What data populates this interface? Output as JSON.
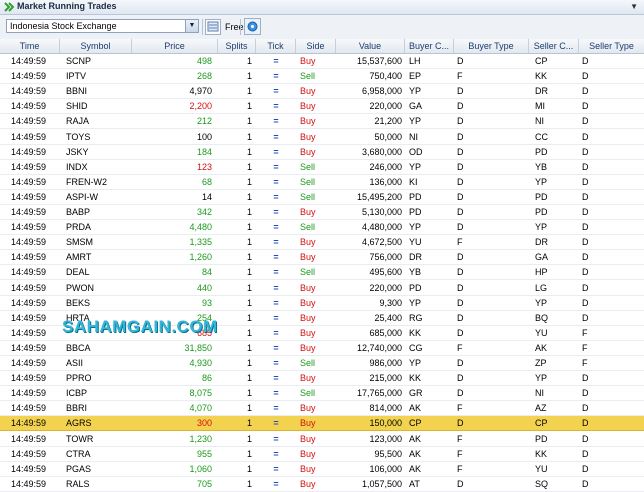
{
  "window": {
    "title": "Market Running Trades"
  },
  "toolbar": {
    "exchange": "Indonesia Stock Exchange",
    "freeze_label": "Freeze"
  },
  "columns": [
    "Time",
    "Symbol",
    "Price",
    "Splits",
    "Tick",
    "Side",
    "Value",
    "Buyer C...",
    "Buyer Type",
    "Seller C...",
    "Seller Type"
  ],
  "watermark": "SAHAMGAIN.COM",
  "colors": {
    "up": "#1a9b1a",
    "down": "#d21010",
    "highlight": "#f2d24f",
    "header_text": "#1e3b6f"
  },
  "trades": [
    {
      "time": "14:49:59",
      "symbol": "SCNP",
      "price": "498",
      "price_dir": "up",
      "splits": "1",
      "tick": "=",
      "side": "Buy",
      "value": "15,537,600",
      "buyer_code": "LH",
      "buyer_type": "D",
      "seller_code": "CP",
      "seller_type": "D"
    },
    {
      "time": "14:49:59",
      "symbol": "IPTV",
      "price": "268",
      "price_dir": "up",
      "splits": "1",
      "tick": "=",
      "side": "Sell",
      "value": "750,400",
      "buyer_code": "EP",
      "buyer_type": "F",
      "seller_code": "KK",
      "seller_type": "D"
    },
    {
      "time": "14:49:59",
      "symbol": "BBNI",
      "price": "4,970",
      "price_dir": "flat",
      "splits": "1",
      "tick": "=",
      "side": "Buy",
      "value": "6,958,000",
      "buyer_code": "YP",
      "buyer_type": "D",
      "seller_code": "DR",
      "seller_type": "D"
    },
    {
      "time": "14:49:59",
      "symbol": "SHID",
      "price": "2,200",
      "price_dir": "down",
      "splits": "1",
      "tick": "=",
      "side": "Buy",
      "value": "220,000",
      "buyer_code": "GA",
      "buyer_type": "D",
      "seller_code": "MI",
      "seller_type": "D"
    },
    {
      "time": "14:49:59",
      "symbol": "RAJA",
      "price": "212",
      "price_dir": "up",
      "splits": "1",
      "tick": "=",
      "side": "Buy",
      "value": "21,200",
      "buyer_code": "YP",
      "buyer_type": "D",
      "seller_code": "NI",
      "seller_type": "D"
    },
    {
      "time": "14:49:59",
      "symbol": "TOYS",
      "price": "100",
      "price_dir": "flat",
      "splits": "1",
      "tick": "=",
      "side": "Buy",
      "value": "50,000",
      "buyer_code": "NI",
      "buyer_type": "D",
      "seller_code": "CC",
      "seller_type": "D"
    },
    {
      "time": "14:49:59",
      "symbol": "JSKY",
      "price": "184",
      "price_dir": "up",
      "splits": "1",
      "tick": "=",
      "side": "Buy",
      "value": "3,680,000",
      "buyer_code": "OD",
      "buyer_type": "D",
      "seller_code": "PD",
      "seller_type": "D"
    },
    {
      "time": "14:49:59",
      "symbol": "INDX",
      "price": "123",
      "price_dir": "down",
      "splits": "1",
      "tick": "=",
      "side": "Sell",
      "value": "246,000",
      "buyer_code": "YP",
      "buyer_type": "D",
      "seller_code": "YB",
      "seller_type": "D"
    },
    {
      "time": "14:49:59",
      "symbol": "FREN-W2",
      "price": "68",
      "price_dir": "up",
      "splits": "1",
      "tick": "=",
      "side": "Sell",
      "value": "136,000",
      "buyer_code": "KI",
      "buyer_type": "D",
      "seller_code": "YP",
      "seller_type": "D"
    },
    {
      "time": "14:49:59",
      "symbol": "ASPI-W",
      "price": "14",
      "price_dir": "flat",
      "splits": "1",
      "tick": "=",
      "side": "Sell",
      "value": "15,495,200",
      "buyer_code": "PD",
      "buyer_type": "D",
      "seller_code": "PD",
      "seller_type": "D"
    },
    {
      "time": "14:49:59",
      "symbol": "BABP",
      "price": "342",
      "price_dir": "up",
      "splits": "1",
      "tick": "=",
      "side": "Buy",
      "value": "5,130,000",
      "buyer_code": "PD",
      "buyer_type": "D",
      "seller_code": "PD",
      "seller_type": "D"
    },
    {
      "time": "14:49:59",
      "symbol": "PRDA",
      "price": "4,480",
      "price_dir": "up",
      "splits": "1",
      "tick": "=",
      "side": "Sell",
      "value": "4,480,000",
      "buyer_code": "YP",
      "buyer_type": "D",
      "seller_code": "YP",
      "seller_type": "D"
    },
    {
      "time": "14:49:59",
      "symbol": "SMSM",
      "price": "1,335",
      "price_dir": "up",
      "splits": "1",
      "tick": "=",
      "side": "Buy",
      "value": "4,672,500",
      "buyer_code": "YU",
      "buyer_type": "F",
      "seller_code": "DR",
      "seller_type": "D"
    },
    {
      "time": "14:49:59",
      "symbol": "AMRT",
      "price": "1,260",
      "price_dir": "up",
      "splits": "1",
      "tick": "=",
      "side": "Buy",
      "value": "756,000",
      "buyer_code": "DR",
      "buyer_type": "D",
      "seller_code": "GA",
      "seller_type": "D"
    },
    {
      "time": "14:49:59",
      "symbol": "DEAL",
      "price": "84",
      "price_dir": "up",
      "splits": "1",
      "tick": "=",
      "side": "Sell",
      "value": "495,600",
      "buyer_code": "YB",
      "buyer_type": "D",
      "seller_code": "HP",
      "seller_type": "D"
    },
    {
      "time": "14:49:59",
      "symbol": "PWON",
      "price": "440",
      "price_dir": "up",
      "splits": "1",
      "tick": "=",
      "side": "Buy",
      "value": "220,000",
      "buyer_code": "PD",
      "buyer_type": "D",
      "seller_code": "LG",
      "seller_type": "D"
    },
    {
      "time": "14:49:59",
      "symbol": "BEKS",
      "price": "93",
      "price_dir": "up",
      "splits": "1",
      "tick": "=",
      "side": "Buy",
      "value": "9,300",
      "buyer_code": "YP",
      "buyer_type": "D",
      "seller_code": "YP",
      "seller_type": "D"
    },
    {
      "time": "14:49:59",
      "symbol": "HRTA",
      "price": "254",
      "price_dir": "up",
      "splits": "1",
      "tick": "=",
      "side": "Buy",
      "value": "25,400",
      "buyer_code": "RG",
      "buyer_type": "D",
      "seller_code": "BQ",
      "seller_type": "D"
    },
    {
      "time": "14:49:59",
      "symbol": "",
      "price": "685",
      "price_dir": "down",
      "splits": "1",
      "tick": "=",
      "side": "Buy",
      "value": "685,000",
      "buyer_code": "KK",
      "buyer_type": "D",
      "seller_code": "YU",
      "seller_type": "F"
    },
    {
      "time": "14:49:59",
      "symbol": "BBCA",
      "price": "31,850",
      "price_dir": "up",
      "splits": "1",
      "tick": "=",
      "side": "Buy",
      "value": "12,740,000",
      "buyer_code": "CG",
      "buyer_type": "F",
      "seller_code": "AK",
      "seller_type": "F"
    },
    {
      "time": "14:49:59",
      "symbol": "ASII",
      "price": "4,930",
      "price_dir": "up",
      "splits": "1",
      "tick": "=",
      "side": "Sell",
      "value": "986,000",
      "buyer_code": "YP",
      "buyer_type": "D",
      "seller_code": "ZP",
      "seller_type": "F"
    },
    {
      "time": "14:49:59",
      "symbol": "PPRO",
      "price": "86",
      "price_dir": "up",
      "splits": "1",
      "tick": "=",
      "side": "Buy",
      "value": "215,000",
      "buyer_code": "KK",
      "buyer_type": "D",
      "seller_code": "YP",
      "seller_type": "D"
    },
    {
      "time": "14:49:59",
      "symbol": "ICBP",
      "price": "8,075",
      "price_dir": "up",
      "splits": "1",
      "tick": "=",
      "side": "Sell",
      "value": "17,765,000",
      "buyer_code": "GR",
      "buyer_type": "D",
      "seller_code": "NI",
      "seller_type": "D"
    },
    {
      "time": "14:49:59",
      "symbol": "BBRI",
      "price": "4,070",
      "price_dir": "up",
      "splits": "1",
      "tick": "=",
      "side": "Buy",
      "value": "814,000",
      "buyer_code": "AK",
      "buyer_type": "F",
      "seller_code": "AZ",
      "seller_type": "D"
    },
    {
      "time": "14:49:59",
      "symbol": "AGRS",
      "price": "300",
      "price_dir": "down",
      "splits": "1",
      "tick": "=",
      "side": "Buy",
      "value": "150,000",
      "buyer_code": "CP",
      "buyer_type": "D",
      "seller_code": "CP",
      "seller_type": "D",
      "highlighted": true
    },
    {
      "time": "14:49:59",
      "symbol": "TOWR",
      "price": "1,230",
      "price_dir": "up",
      "splits": "1",
      "tick": "=",
      "side": "Buy",
      "value": "123,000",
      "buyer_code": "AK",
      "buyer_type": "F",
      "seller_code": "PD",
      "seller_type": "D"
    },
    {
      "time": "14:49:59",
      "symbol": "CTRA",
      "price": "955",
      "price_dir": "up",
      "splits": "1",
      "tick": "=",
      "side": "Buy",
      "value": "95,500",
      "buyer_code": "AK",
      "buyer_type": "F",
      "seller_code": "KK",
      "seller_type": "D"
    },
    {
      "time": "14:49:59",
      "symbol": "PGAS",
      "price": "1,060",
      "price_dir": "up",
      "splits": "1",
      "tick": "=",
      "side": "Buy",
      "value": "106,000",
      "buyer_code": "AK",
      "buyer_type": "F",
      "seller_code": "YU",
      "seller_type": "D"
    },
    {
      "time": "14:49:59",
      "symbol": "RALS",
      "price": "705",
      "price_dir": "up",
      "splits": "1",
      "tick": "=",
      "side": "Buy",
      "value": "1,057,500",
      "buyer_code": "AT",
      "buyer_type": "D",
      "seller_code": "SQ",
      "seller_type": "D"
    }
  ]
}
